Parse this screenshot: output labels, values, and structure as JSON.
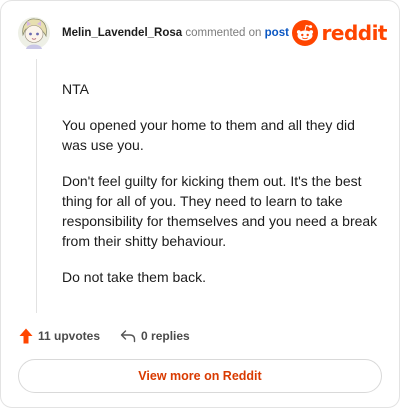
{
  "comment": {
    "username": "Melin_Lavendel_Rosa",
    "action_text": "commented on",
    "post_link": "post",
    "avatar": "avatar-illustration",
    "body": [
      "NTA",
      "You opened your home to them and all they did was use you.",
      "Don't feel guilty for kicking them out. It's the best thing for all of you. They need to learn to take responsibility for themselves and you need a break from their shitty behaviour.",
      "Do not take them back."
    ],
    "upvotes": "11 upvotes",
    "replies": "0 replies"
  },
  "brand": {
    "name": "reddit",
    "icon": "reddit-logo-icon",
    "color": "#ff4500"
  },
  "footer": {
    "view_more_label": "View more on Reddit"
  },
  "colors": {
    "upvote": "#ff4500",
    "link": "#0a56c2",
    "view_more": "#d93a00"
  },
  "icons": {
    "upvote": "upvote-arrow-icon",
    "reply": "reply-arrow-icon"
  }
}
